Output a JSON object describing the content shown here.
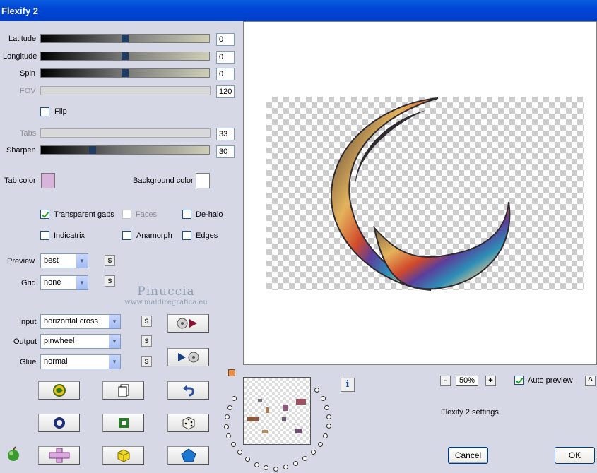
{
  "window": {
    "title": "Flexify 2"
  },
  "sliders": {
    "latitude": {
      "label": "Latitude",
      "value": "0",
      "level": 0.5,
      "enabled": true
    },
    "longitude": {
      "label": "Longitude",
      "value": "0",
      "level": 0.5,
      "enabled": true
    },
    "spin": {
      "label": "Spin",
      "value": "0",
      "level": 0.5,
      "enabled": true
    },
    "fov": {
      "label": "FOV",
      "value": "120",
      "enabled": false
    },
    "tabs": {
      "label": "Tabs",
      "value": "33",
      "enabled": false
    },
    "sharpen": {
      "label": "Sharpen",
      "value": "30",
      "level": 0.3,
      "enabled": true
    }
  },
  "flip": {
    "label": "Flip",
    "checked": false
  },
  "colors": {
    "tab_color_label": "Tab color",
    "tab_color": "#d8b4dc",
    "background_color_label": "Background color",
    "background_color": "#ffffff"
  },
  "options": {
    "transparent_gaps": {
      "label": "Transparent gaps",
      "checked": true
    },
    "faces": {
      "label": "Faces",
      "checked": false,
      "enabled": false
    },
    "de_halo": {
      "label": "De-halo",
      "checked": false
    },
    "indicatrix": {
      "label": "Indicatrix",
      "checked": false
    },
    "anamorph": {
      "label": "Anamorph",
      "checked": false
    },
    "edges": {
      "label": "Edges",
      "checked": false
    }
  },
  "preview_select": {
    "label": "Preview",
    "value": "best"
  },
  "grid_select": {
    "label": "Grid",
    "value": "none"
  },
  "input_select": {
    "label": "Input",
    "value": "horizontal cross"
  },
  "output_select": {
    "label": "Output",
    "value": "pinwheel"
  },
  "glue_select": {
    "label": "Glue",
    "value": "normal"
  },
  "s_label": "S",
  "watermark": {
    "line1": "Pinuccia",
    "line2": "www.maidiregrafica.eu"
  },
  "zoom": {
    "minus": "-",
    "value": "50%",
    "plus": "+"
  },
  "auto_preview": {
    "label": "Auto preview",
    "checked": true
  },
  "scroll_up": "^",
  "info_label": "i",
  "settings_label": "Flexify 2 settings",
  "buttons": {
    "cancel": "Cancel",
    "ok": "OK"
  }
}
